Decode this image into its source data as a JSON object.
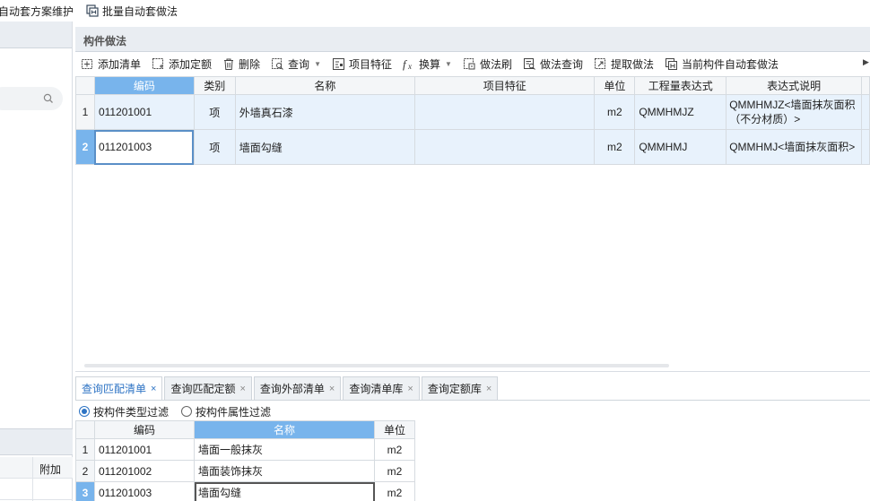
{
  "topbar": {
    "items": [
      {
        "label": "自动套方案维护",
        "icon": "none"
      },
      {
        "label": "批量自动套做法",
        "icon": "batch-apply-icon"
      }
    ]
  },
  "panel": {
    "title": "构件做法"
  },
  "toolbar": {
    "add_list": "添加清单",
    "add_quota": "添加定额",
    "delete": "删除",
    "query": "查询",
    "item_feature": "项目特征",
    "convert": "换算",
    "method_brush": "做法刷",
    "method_query": "做法查询",
    "extract_method": "提取做法",
    "current_auto_apply": "当前构件自动套做法"
  },
  "main_table": {
    "columns": [
      "编码",
      "类别",
      "名称",
      "项目特征",
      "单位",
      "工程量表达式",
      "表达式说明"
    ],
    "rows": [
      {
        "idx": "1",
        "code": "011201001",
        "category": "项",
        "name": "外墙真石漆",
        "feature": "",
        "unit": "m2",
        "expr": "QMMHMJZ",
        "desc": "QMMHMJZ<墙面抹灰面积（不分材质）>"
      },
      {
        "idx": "2",
        "code": "011201003",
        "category": "项",
        "name": "墙面勾缝",
        "feature": "",
        "unit": "m2",
        "expr": "QMMHMJ",
        "desc": "QMMHMJ<墙面抹灰面积>"
      }
    ]
  },
  "tabs": [
    {
      "label": "查询匹配清单",
      "active": true
    },
    {
      "label": "查询匹配定额",
      "active": false
    },
    {
      "label": "查询外部清单",
      "active": false
    },
    {
      "label": "查询清单库",
      "active": false
    },
    {
      "label": "查询定额库",
      "active": false
    }
  ],
  "filters": {
    "by_type": "按构件类型过滤",
    "by_attr": "按构件属性过滤"
  },
  "match_table": {
    "columns": [
      "编码",
      "名称",
      "单位"
    ],
    "rows": [
      {
        "idx": "1",
        "code": "011201001",
        "name": "墙面一般抹灰",
        "unit": "m2"
      },
      {
        "idx": "2",
        "code": "011201002",
        "name": "墙面装饰抹灰",
        "unit": "m2"
      },
      {
        "idx": "3",
        "code": "011201003",
        "name": "墙面勾缝",
        "unit": "m2"
      }
    ]
  },
  "left_grid": {
    "header": "附加"
  },
  "colors": {
    "selected_header": "#78b4ec",
    "row_highlight": "#e8f2fc",
    "accent": "#2d73c4"
  }
}
